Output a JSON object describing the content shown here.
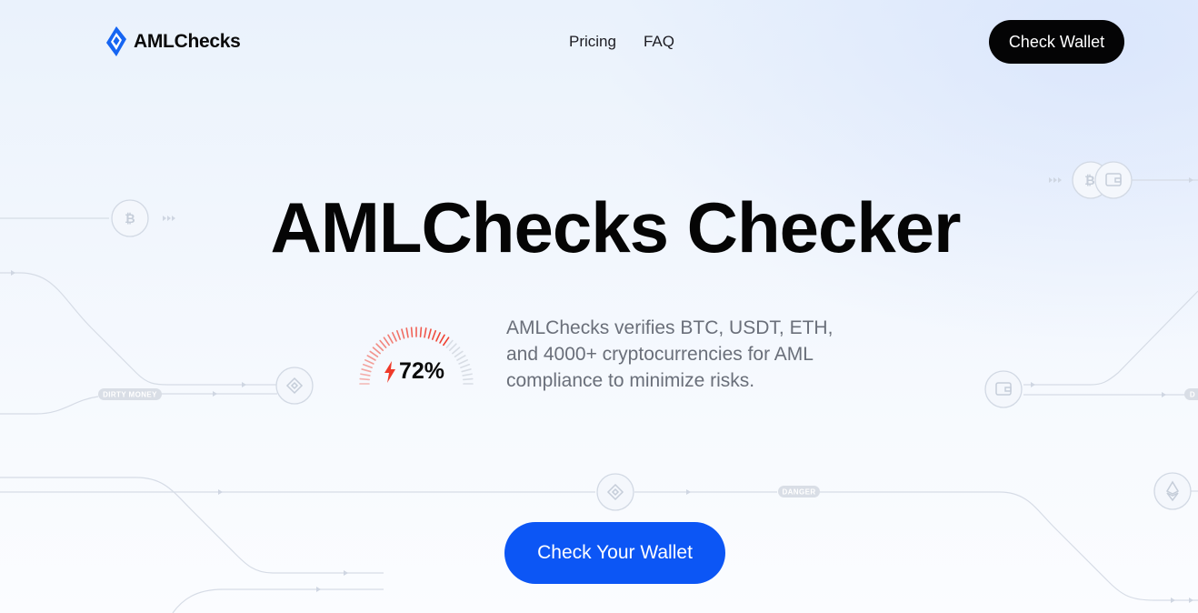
{
  "header": {
    "brand": "AMLChecks",
    "nav": [
      {
        "label": "Pricing"
      },
      {
        "label": "FAQ"
      }
    ],
    "cta_label": "Check Wallet"
  },
  "hero": {
    "title": "AMLChecks Checker",
    "score": {
      "value": 72,
      "display": "72%"
    },
    "description": "AMLChecks verifies BTC, USDT, ETH, and 4000+ cryptocurrencies for AML compliance to minimize risks.",
    "cta_label": "Check Your Wallet"
  },
  "background": {
    "tags": [
      "DIRTY MONEY",
      "DANGER",
      "D"
    ],
    "icons": [
      "bitcoin-icon",
      "binance-icon",
      "wallet-icon",
      "ethereum-icon"
    ]
  },
  "colors": {
    "accent_blue": "#0c56f5",
    "logo_blue": "#1665f2",
    "gauge_red": "#ef3a2a",
    "dark_button": "#040405",
    "body_text_gray": "#6a6f7a",
    "circuit_line": "#d4dae4"
  },
  "icons": {
    "logo": "amlchecks-logo-icon",
    "bolt": "lightning-bolt-icon"
  }
}
